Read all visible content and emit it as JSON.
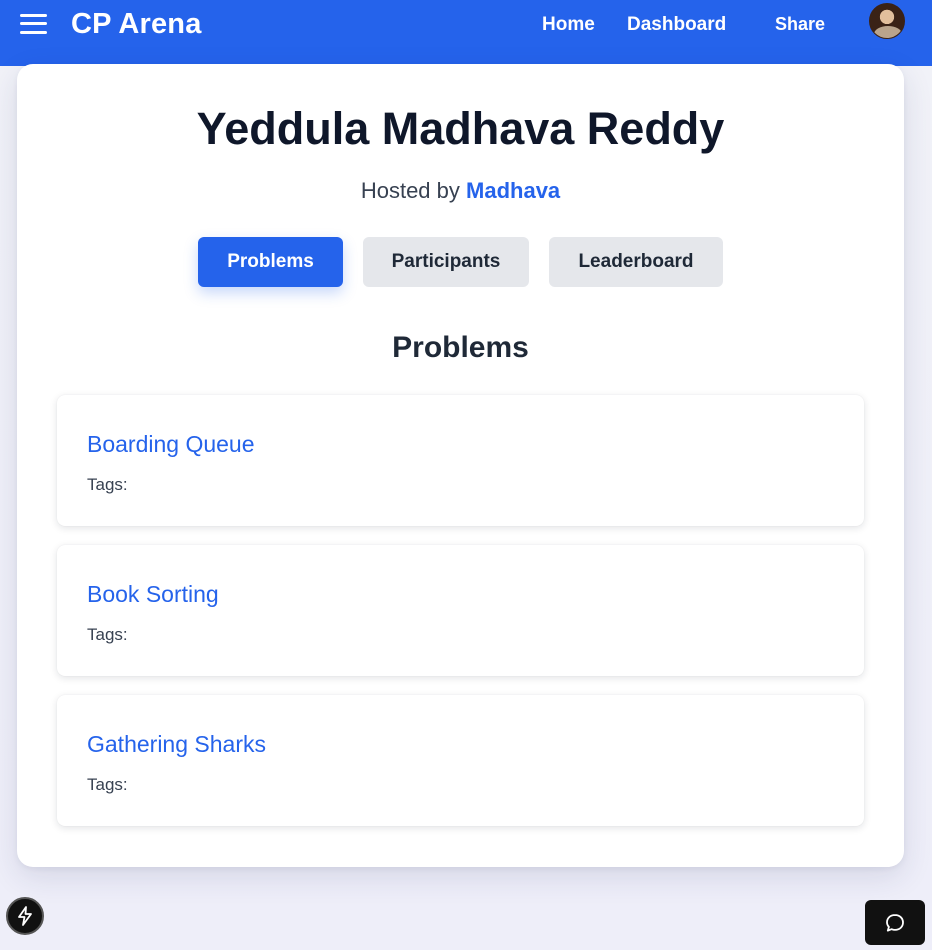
{
  "navbar": {
    "brand": "CP Arena",
    "links": [
      "Home",
      "Dashboard",
      "Share"
    ],
    "bg_color": "#2563eb"
  },
  "contest": {
    "title": "Yeddula Madhava Reddy",
    "hosted_prefix": "Hosted by",
    "host": "Madhava"
  },
  "tabs": [
    {
      "label": "Problems",
      "active": true
    },
    {
      "label": "Participants",
      "active": false
    },
    {
      "label": "Leaderboard",
      "active": false
    }
  ],
  "section_title": "Problems",
  "problems": [
    {
      "name": "Boarding Queue",
      "tags_label": "Tags:"
    },
    {
      "name": "Book Sorting",
      "tags_label": "Tags:"
    },
    {
      "name": "Gathering Sharks",
      "tags_label": "Tags:"
    }
  ],
  "icons": {
    "menu": "hamburger-menu-icon",
    "avatar": "user-avatar",
    "bolt": "lightning-bolt-icon",
    "chat": "chat-bubble-icon"
  },
  "colors": {
    "accent": "#2563eb",
    "title": "#0f172a",
    "tab_inactive": "#e5e7eb"
  }
}
